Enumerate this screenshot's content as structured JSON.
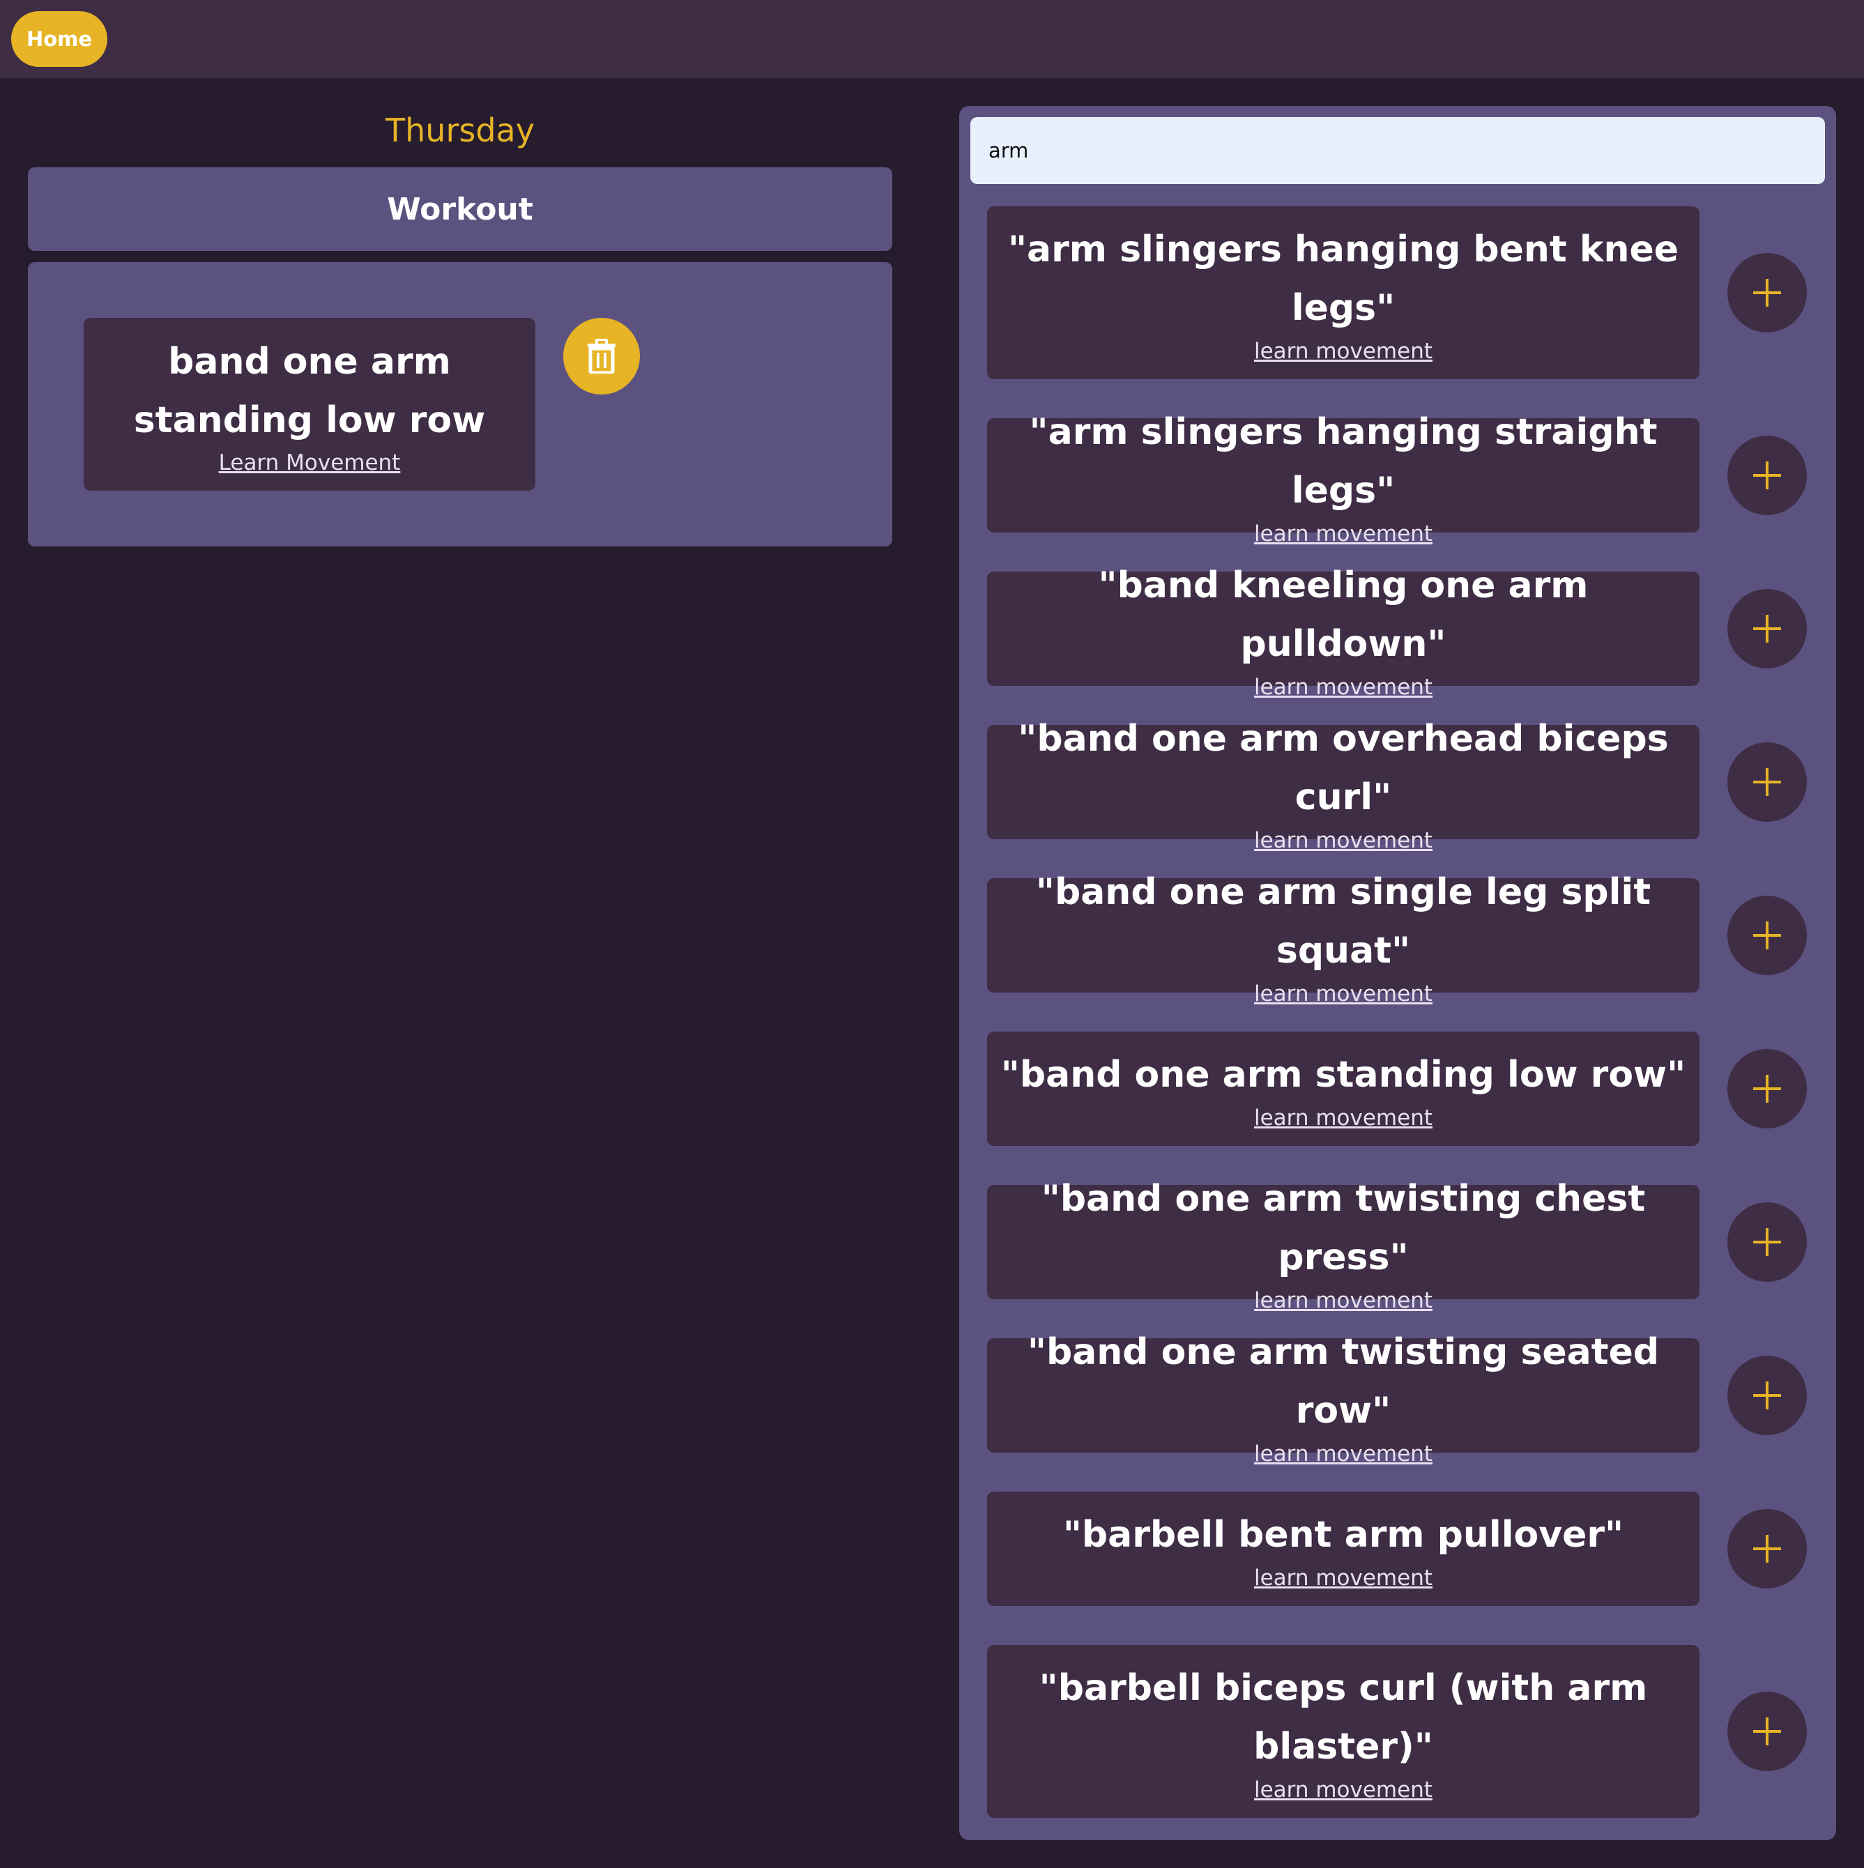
{
  "nav": {
    "home_label": "Home"
  },
  "day": {
    "title": "Thursday"
  },
  "workout": {
    "header": "Workout",
    "items": [
      {
        "title": "band one arm standing low row",
        "link": "Learn Movement"
      }
    ]
  },
  "search": {
    "value": "arm",
    "results": [
      {
        "title": "\"arm slingers hanging bent knee legs\"",
        "link": "learn movement"
      },
      {
        "title": "\"arm slingers hanging straight legs\"",
        "link": "learn movement"
      },
      {
        "title": "\"band kneeling one arm pulldown\"",
        "link": "learn movement"
      },
      {
        "title": "\"band one arm overhead biceps curl\"",
        "link": "learn movement"
      },
      {
        "title": "\"band one arm single leg split squat\"",
        "link": "learn movement"
      },
      {
        "title": "\"band one arm standing low row\"",
        "link": "learn movement"
      },
      {
        "title": "\"band one arm twisting chest press\"",
        "link": "learn movement"
      },
      {
        "title": "\"band one arm twisting seated row\"",
        "link": "learn movement"
      },
      {
        "title": "\"barbell bent arm pullover\"",
        "link": "learn movement"
      },
      {
        "title": "\"barbell biceps curl (with arm blaster)\"",
        "link": "learn movement"
      }
    ]
  },
  "colors": {
    "accent": "#e6b425",
    "panel": "#5c5280",
    "card": "#3e2d44",
    "background": "#261c2e"
  },
  "icons": {
    "delete": "trash-icon",
    "add": "plus-icon"
  }
}
